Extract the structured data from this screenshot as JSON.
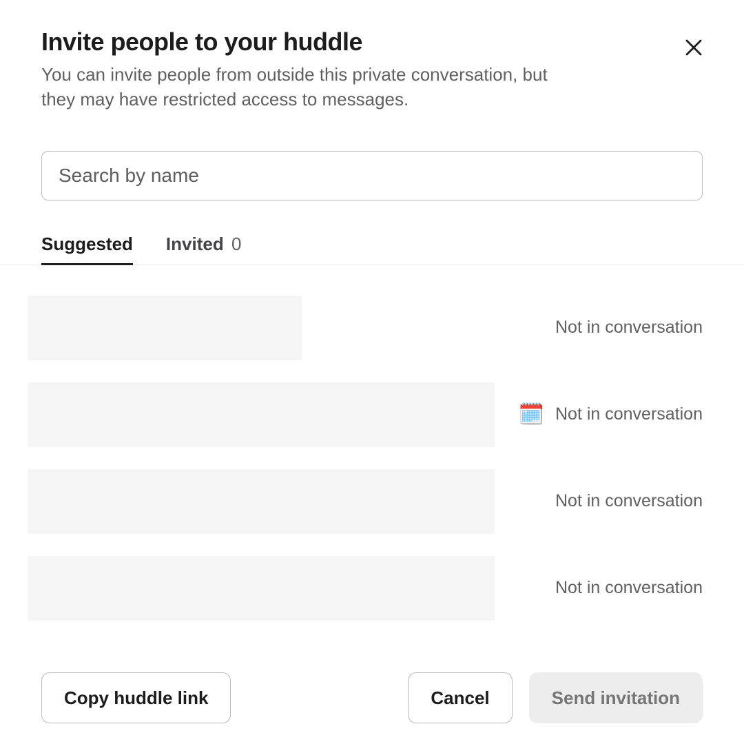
{
  "header": {
    "title": "Invite people to your huddle",
    "subtitle": "You can invite people from outside this private conversation, but they may have restricted access to messages."
  },
  "search": {
    "placeholder": "Search by name",
    "value": ""
  },
  "tabs": {
    "suggested": {
      "label": "Suggested",
      "active": true
    },
    "invited": {
      "label": "Invited",
      "count": "0",
      "active": false
    }
  },
  "suggestions": [
    {
      "placeholder_width": 398,
      "status_emoji": "",
      "conversation_status": "Not in conversation"
    },
    {
      "placeholder_width": 678,
      "status_emoji": "🗓️",
      "conversation_status": "Not in conversation"
    },
    {
      "placeholder_width": 678,
      "status_emoji": "",
      "conversation_status": "Not in conversation"
    },
    {
      "placeholder_width": 678,
      "status_emoji": "",
      "conversation_status": "Not in conversation"
    }
  ],
  "footer": {
    "copy_link": "Copy huddle link",
    "cancel": "Cancel",
    "send": "Send invitation",
    "send_enabled": false
  }
}
